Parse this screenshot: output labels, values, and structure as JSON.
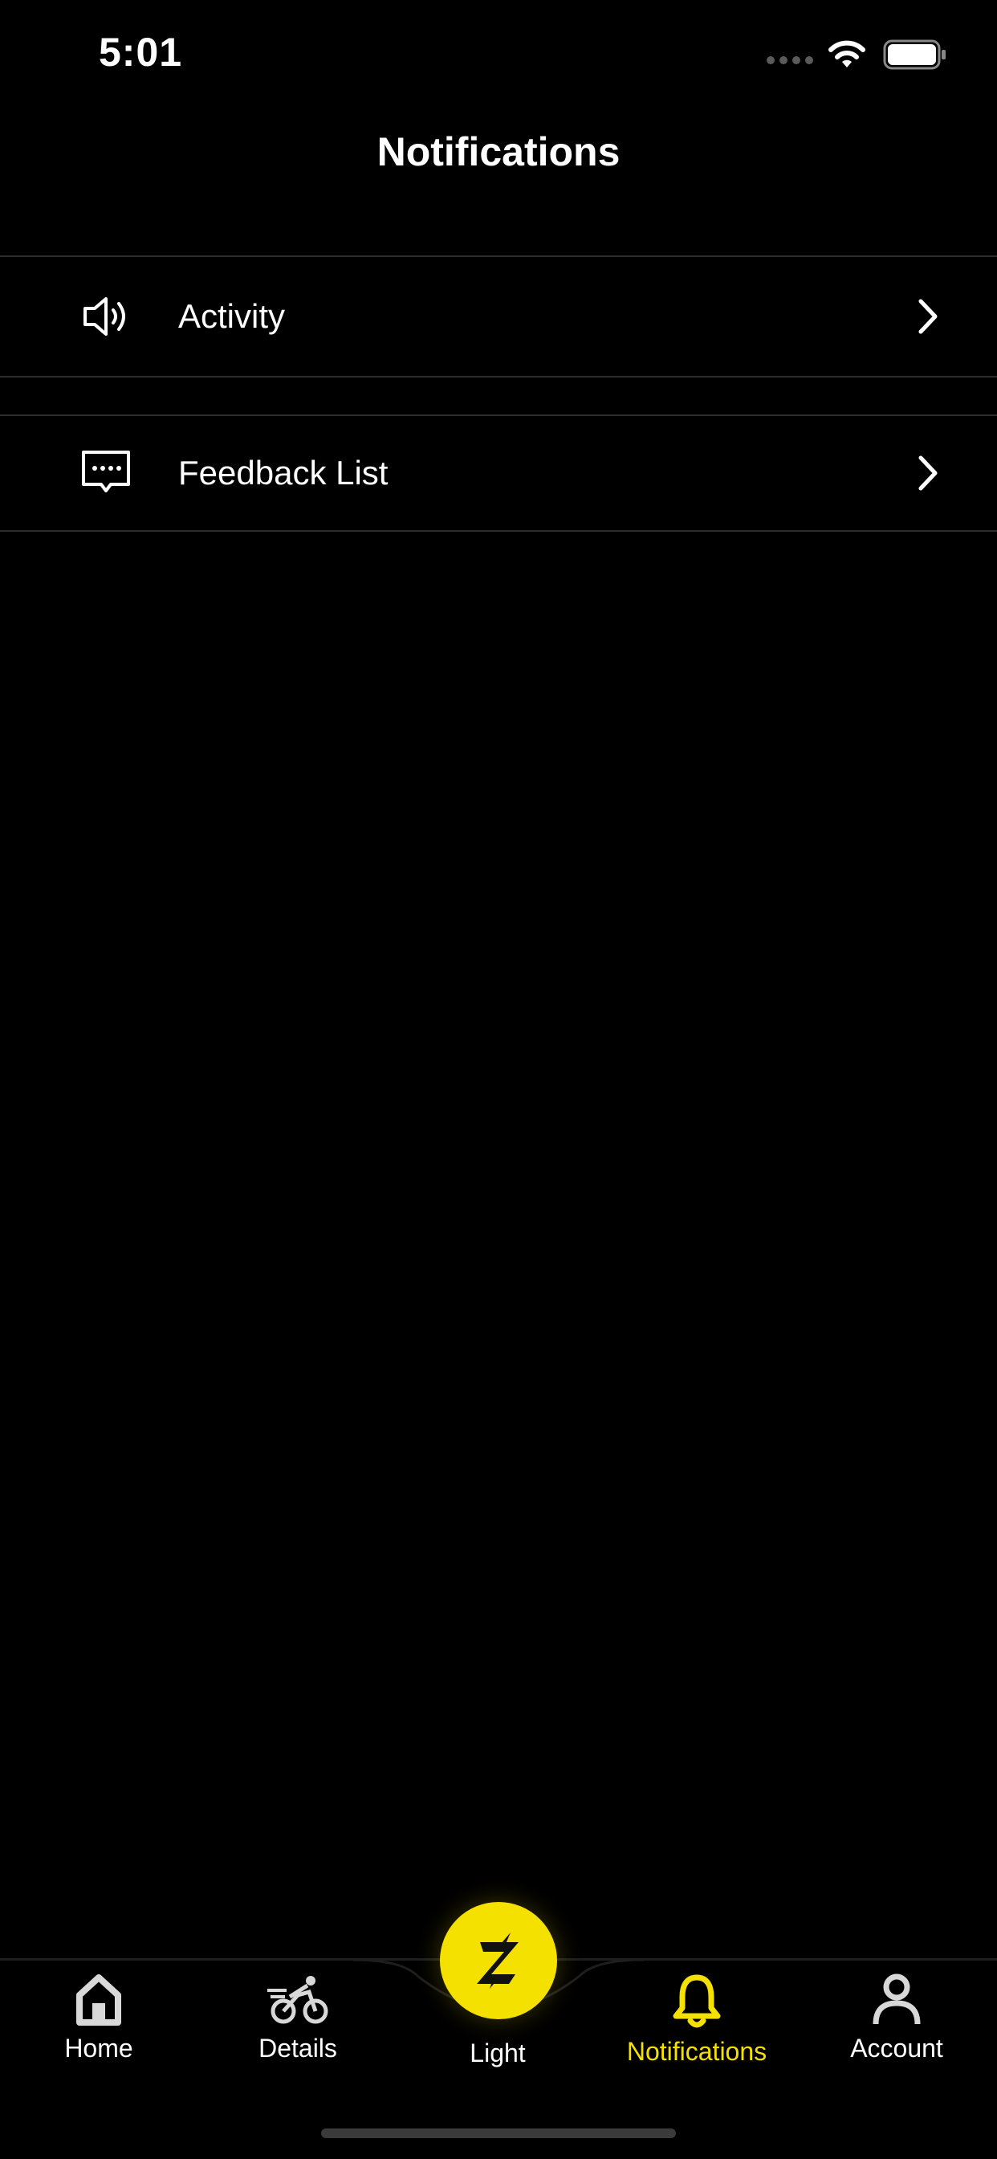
{
  "status_bar": {
    "time": "5:01"
  },
  "header": {
    "title": "Notifications"
  },
  "list": [
    {
      "label": "Activity",
      "icon": "speaker-icon"
    },
    {
      "label": "Feedback List",
      "icon": "message-icon"
    }
  ],
  "tab_bar": {
    "home": "Home",
    "details": "Details",
    "light": "Light",
    "notifications": "Notifications",
    "account": "Account",
    "active": "notifications"
  },
  "colors": {
    "accent": "#f5e100",
    "background": "#000000",
    "divider": "#2c2c2c"
  }
}
